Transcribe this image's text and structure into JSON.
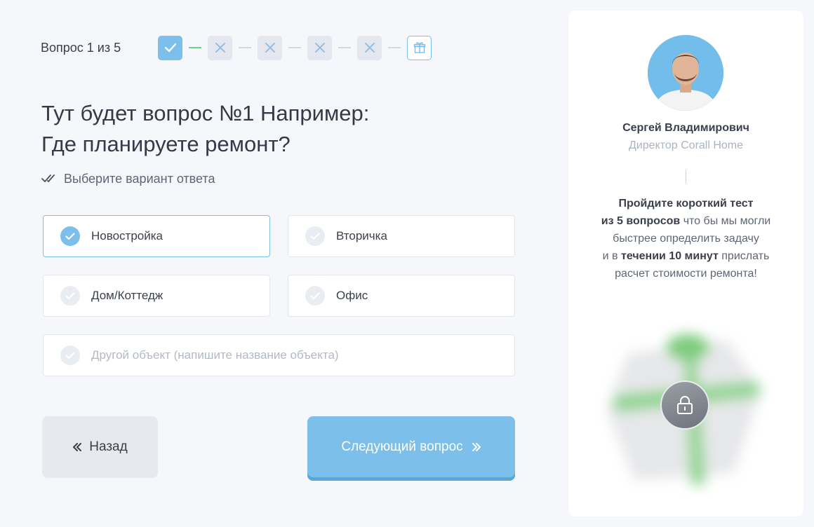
{
  "progress": {
    "label": "Вопрос 1 из 5",
    "steps": [
      "done",
      "pending",
      "pending",
      "pending",
      "pending",
      "gift"
    ]
  },
  "question": {
    "line1": "Тут будет вопрос №1 Например:",
    "line2": "Где планируете ремонт?",
    "hint": "Выберите вариант ответа"
  },
  "options": [
    {
      "label": "Новостройка",
      "selected": true
    },
    {
      "label": "Вторичка",
      "selected": false
    },
    {
      "label": "Дом/Коттедж",
      "selected": false
    },
    {
      "label": "Офис",
      "selected": false
    }
  ],
  "other_option": {
    "placeholder": "Другой объект (напишите название объекта)"
  },
  "buttons": {
    "back": "Назад",
    "next": "Следующий вопрос"
  },
  "manager": {
    "name": "Сергей Владимирович",
    "role": "Директор Corall Home"
  },
  "promo": {
    "b1": "Пройдите короткий тест",
    "b2": "из 5 вопросов",
    "t1": " что бы мы могли",
    "t2": "быстрее определить задачу",
    "t3": "и в ",
    "b3": "течении 10 минут",
    "t4": " прислать",
    "t5": "расчет стоимости ремонта!"
  },
  "colors": {
    "accent": "#7bbfea",
    "background": "#f5f7fa",
    "success": "#6fcf8f"
  },
  "icons": {
    "check": "check-icon",
    "cross": "cross-icon",
    "gift": "gift-icon",
    "lock": "lock-icon",
    "double_check": "double-check-icon"
  }
}
